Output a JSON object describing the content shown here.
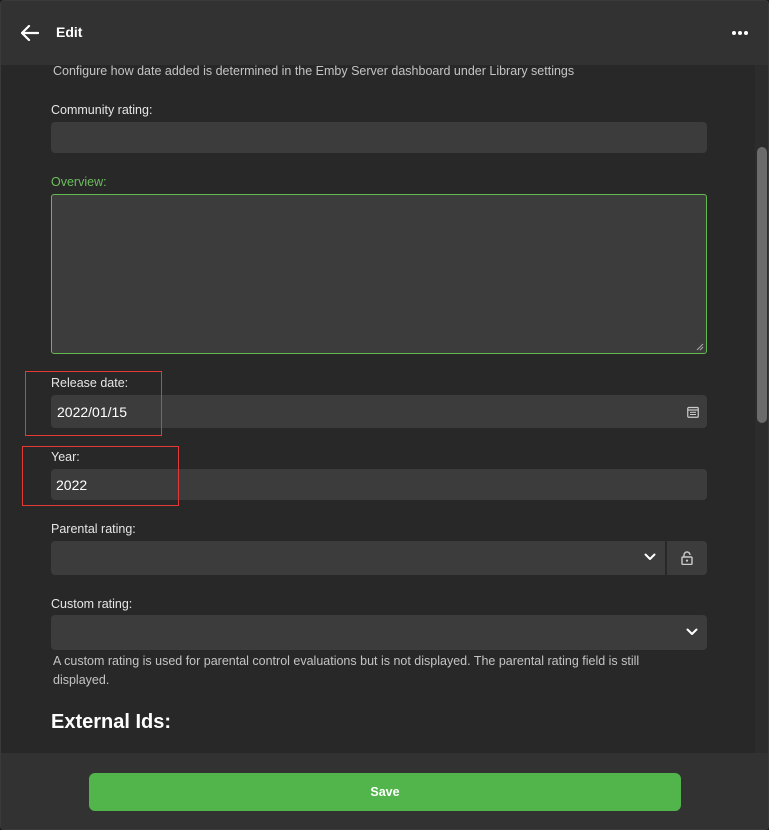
{
  "header": {
    "title": "Edit"
  },
  "form": {
    "date_added_note": "Configure how date added is determined in the Emby Server dashboard under Library settings",
    "community_rating": {
      "label": "Community rating:",
      "value": ""
    },
    "overview": {
      "label": "Overview:",
      "value": ""
    },
    "release_date": {
      "label": "Release date:",
      "value": "2022/01/15"
    },
    "year": {
      "label": "Year:",
      "value": "2022"
    },
    "parental_rating": {
      "label": "Parental rating:",
      "value": ""
    },
    "custom_rating": {
      "label": "Custom rating:",
      "value": "",
      "help_line1": "A custom rating is used for parental control evaluations but is not displayed. The parental rating field is still",
      "help_line2": "displayed."
    },
    "external_ids_heading": "External Ids:"
  },
  "footer": {
    "save_label": "Save"
  },
  "colors": {
    "accent": "#52b54b",
    "focus_border": "#65b84f",
    "highlight": "#e53935"
  }
}
